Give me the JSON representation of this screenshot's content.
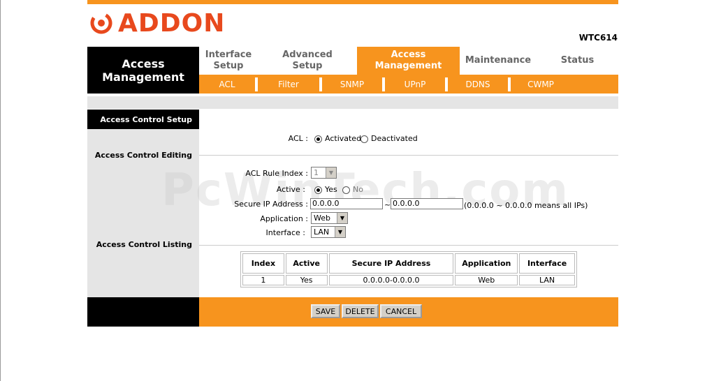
{
  "brand": {
    "logo_text": "ADDON",
    "model": "WTC614",
    "accent_color": "#f7941e",
    "logo_color": "#e8491d"
  },
  "sidebar": {
    "title_line1": "Access",
    "title_line2": "Management"
  },
  "tabs": [
    {
      "line1": "Interface",
      "line2": "Setup"
    },
    {
      "line1": "Advanced",
      "line2": "Setup"
    },
    {
      "line1": "Access",
      "line2": "Management"
    },
    {
      "line1": "Maintenance",
      "line2": ""
    },
    {
      "line1": "Status",
      "line2": ""
    }
  ],
  "subtabs": [
    "ACL",
    "Filter",
    "SNMP",
    "UPnP",
    "DDNS",
    "CWMP"
  ],
  "sections": {
    "setup": "Access Control Setup",
    "editing": "Access Control Editing",
    "listing": "Access Control Listing"
  },
  "acl": {
    "label": "ACL :",
    "activated": "Activated",
    "deactivated": "Deactivated"
  },
  "form": {
    "rule_index_label": "ACL Rule Index :",
    "rule_index_value": "1",
    "active_label": "Active :",
    "yes": "Yes",
    "no": "No",
    "secure_ip_label": "Secure IP Address :",
    "ip_start": "0.0.0.0",
    "tilde": "~",
    "ip_end": "0.0.0.0",
    "ip_hint": "(0.0.0.0 ~ 0.0.0.0 means all IPs)",
    "application_label": "Application :",
    "application_value": "Web",
    "interface_label": "Interface :",
    "interface_value": "LAN"
  },
  "table": {
    "headers": [
      "Index",
      "Active",
      "Secure IP Address",
      "Application",
      "Interface"
    ],
    "rows": [
      [
        "1",
        "Yes",
        "0.0.0.0-0.0.0.0",
        "Web",
        "LAN"
      ]
    ]
  },
  "buttons": {
    "save": "SAVE",
    "delete": "DELETE",
    "cancel": "CANCEL"
  },
  "watermark": "PcWinTech.com"
}
